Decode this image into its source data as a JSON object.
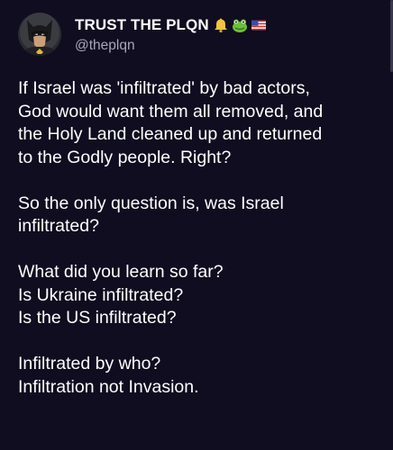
{
  "post": {
    "author": {
      "display_name": "TRUST THE PLQN",
      "handle": "@theplqn",
      "badges": [
        "bell-emoji",
        "frog-emoji",
        "us-flag-emoji"
      ]
    },
    "body": {
      "paragraph1": [
        "If Israel was 'infiltrated' by bad actors,",
        "God would want them all removed, and",
        "the Holy Land cleaned up and returned",
        "to the Godly people. Right?"
      ],
      "paragraph2": [
        "So the only question is, was Israel",
        "infiltrated?"
      ],
      "paragraph3": [
        "What did you learn so far?",
        "Is Ukraine infiltrated?",
        "Is the US infiltrated?"
      ],
      "paragraph4": [
        "Infiltrated by who?",
        "Infiltration not Invasion."
      ]
    }
  },
  "colors": {
    "background": "#0f0d1f",
    "text": "#ffffff",
    "handle": "#a9a6b8"
  }
}
